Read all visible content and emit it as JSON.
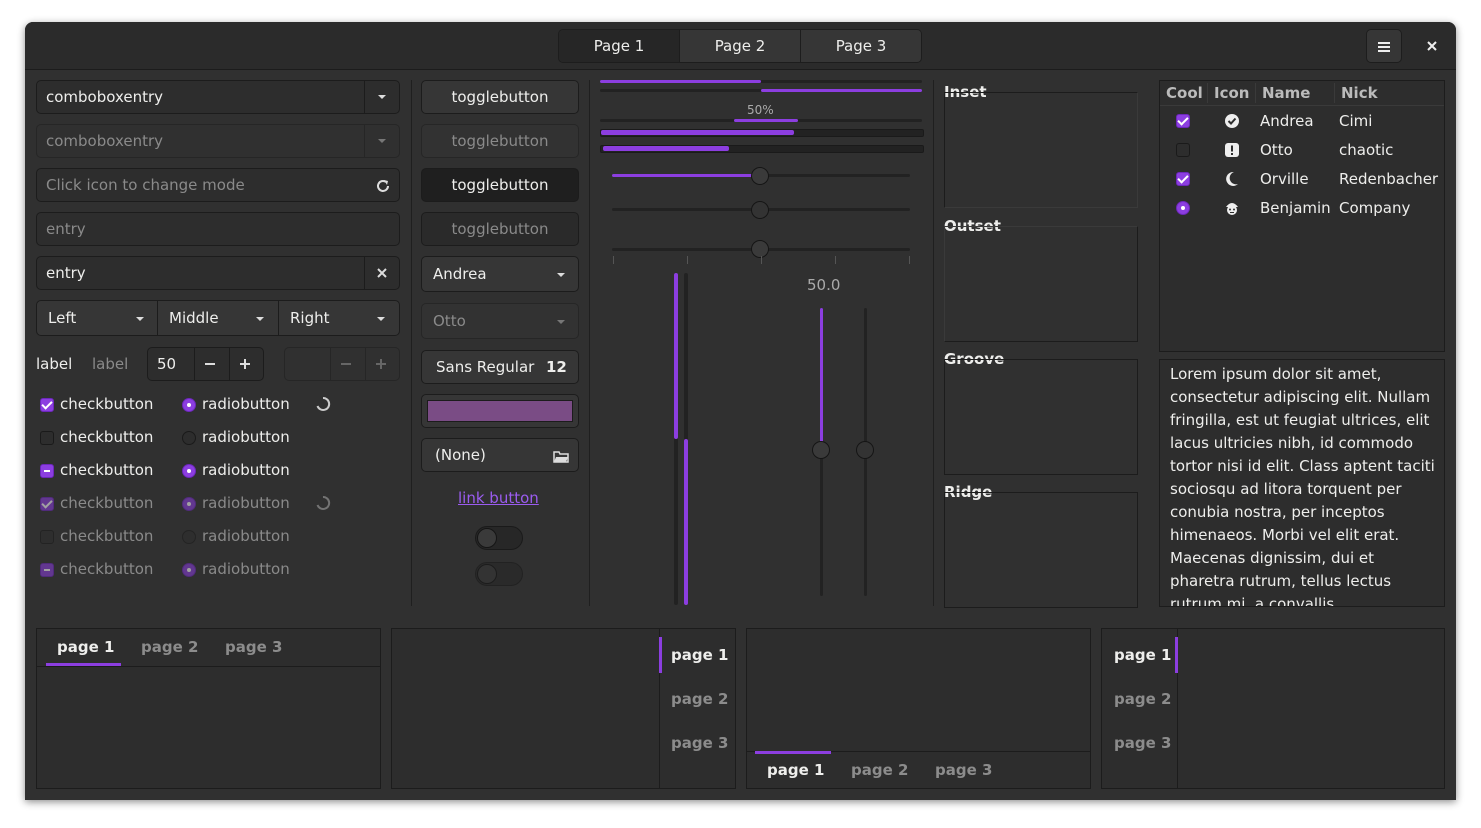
{
  "header": {
    "stack_pages": [
      "Page 1",
      "Page 2",
      "Page 3"
    ],
    "menu_icon": "hamburger-menu-icon",
    "close_icon": "close-icon"
  },
  "left": {
    "combo1_value": "comboboxentry",
    "combo2_value": "comboboxentry",
    "mode_entry_placeholder": "Click icon to change mode",
    "entry_placeholder": "entry",
    "entry_value": "entry",
    "linked_combos": [
      "Left",
      "Middle",
      "Right"
    ],
    "label1": "label",
    "label2": "label",
    "spin_value": "50",
    "checkbuttons": [
      "checkbutton",
      "checkbutton",
      "checkbutton",
      "checkbutton",
      "checkbutton",
      "checkbutton"
    ],
    "radiobuttons": [
      "radiobutton",
      "radiobutton",
      "radiobutton",
      "radiobutton",
      "radiobutton",
      "radiobutton"
    ]
  },
  "middle": {
    "togglebuttons": [
      "togglebutton",
      "togglebutton",
      "togglebutton",
      "togglebutton"
    ],
    "combo_andrea": "Andrea",
    "combo_otto": "Otto",
    "font_name": "Sans Regular",
    "font_size": "12",
    "color_swatch": "#7a4c85",
    "file_chooser": "(None)",
    "link_button": "link button",
    "switch1_on": false,
    "switch2_on": false
  },
  "progress": {
    "label_50": "50%",
    "scale_value_label": "50.0",
    "bar_1_fraction": 0.5,
    "bar_2_fraction": 0.5,
    "bar_3_fraction": 0.6,
    "scale_h1_fraction": 0.5,
    "scale_v_fraction": 0.5
  },
  "frames": [
    "Inset",
    "Outset",
    "Groove",
    "Ridge"
  ],
  "tree": {
    "columns": [
      "Cool",
      "Icon",
      "Name",
      "Nick"
    ],
    "rows": [
      {
        "cool": "checked",
        "icon": "check-circle-icon",
        "name": "Andrea",
        "nick": "Cimi"
      },
      {
        "cool": "unchecked",
        "icon": "warning-icon",
        "name": "Otto",
        "nick": "chaotic"
      },
      {
        "cool": "checked",
        "icon": "moon-icon",
        "name": "Orville",
        "nick": "Redenbacher"
      },
      {
        "cool": "radio",
        "icon": "face-icon",
        "name": "Benjamin",
        "nick": "Company"
      }
    ]
  },
  "textview": "Lorem ipsum dolor sit amet, consectetur adipiscing elit. Nullam fringilla, est ut feugiat ultrices, elit lacus ultricies nibh, id commodo tortor nisi id elit. Class aptent taciti sociosqu ad litora torquent per conubia nostra, per inceptos himenaeos. Morbi vel elit erat. Maecenas dignissim, dui et pharetra rutrum, tellus lectus rutrum mi, a convallis",
  "notebooks": {
    "tabs": [
      "page 1",
      "page 2",
      "page 3"
    ]
  },
  "colors": {
    "accent": "#8c3ee0",
    "window_bg": "#303030",
    "entry_bg": "#2d2d2d"
  }
}
